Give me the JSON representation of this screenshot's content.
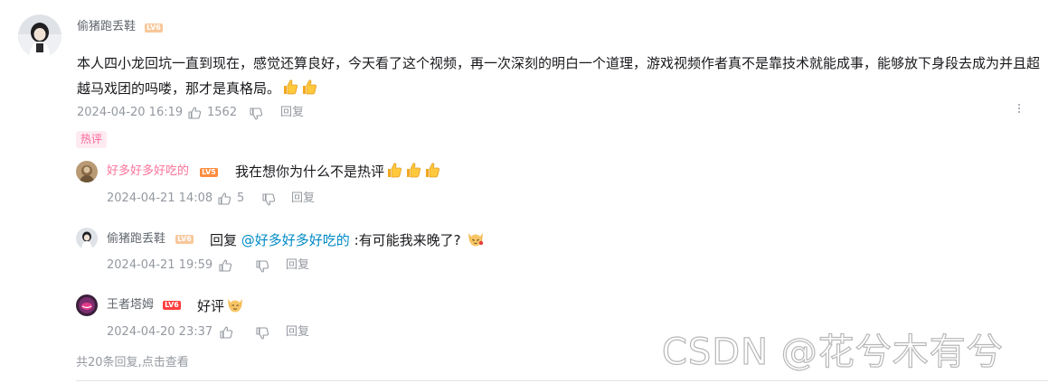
{
  "main_comment": {
    "username": "偷猪跑丢鞋",
    "level": "LV6",
    "text": "本人四小龙回坑一直到现在，感觉还算良好，今天看了这个视频，再一次深刻的明白一个道理，游戏视频作者真不是靠技术就能成事，能够放下身段去成为并且超越马戏团的吗喽，那才是真格局。",
    "emoji": [
      "thumbs-up",
      "thumbs-up"
    ],
    "time": "2024-04-20 16:19",
    "likes": "1562",
    "reply_label": "回复",
    "hot_badge": "热评"
  },
  "replies": [
    {
      "username": "好多好多好吃的",
      "level": "LV5",
      "text": "我在想你为什么不是热评",
      "time": "2024-04-21 14:08",
      "likes": "5",
      "reply_label": "回复"
    },
    {
      "username": "偷猪跑丢鞋",
      "level": "LV6",
      "reply_prefix": "回复",
      "mention": "@好多好多好吃的",
      "text": " :有可能我来晚了?",
      "time": "2024-04-21 19:59",
      "reply_label": "回复"
    },
    {
      "username": "王者塔姆",
      "level": "LV6",
      "text": "好评",
      "time": "2024-04-20 23:37",
      "reply_label": "回复"
    }
  ],
  "footer": {
    "summary_prefix": "共20条回复,",
    "view_link": "点击查看"
  },
  "watermark": "CSDN @花兮木有兮",
  "colors": {
    "name_default": "#61666d",
    "name_vip": "#fb7299",
    "meta": "#9499a0",
    "mention": "#008ac5",
    "level_orange": "#f5a56f",
    "level_red": "#ff6a3d"
  }
}
